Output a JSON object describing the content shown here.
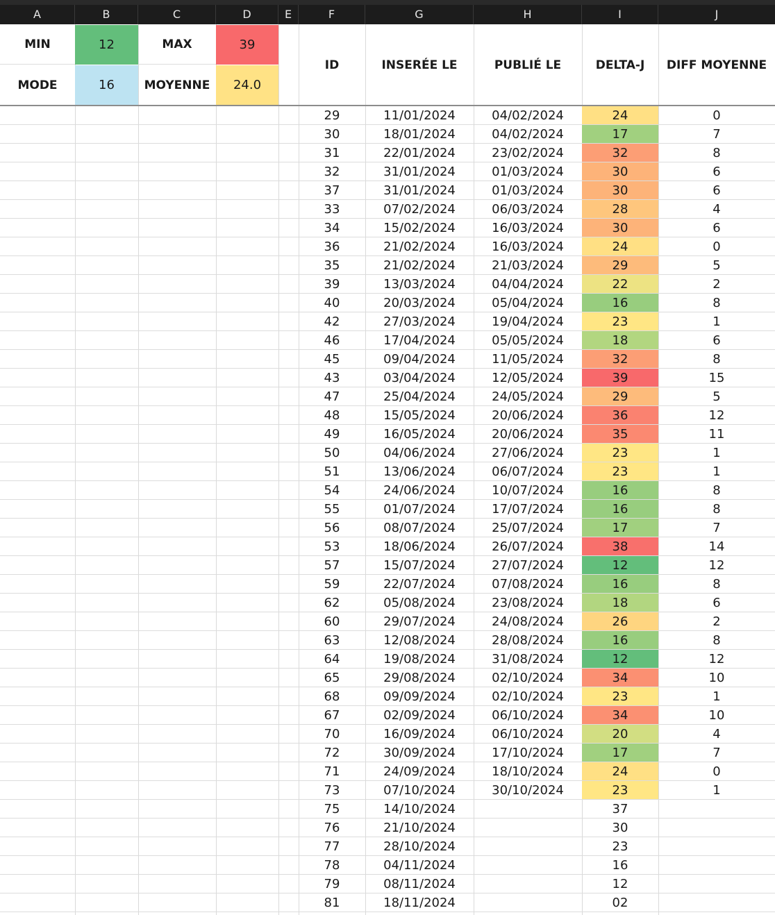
{
  "columns": [
    "A",
    "B",
    "C",
    "D",
    "E",
    "F",
    "G",
    "H",
    "I",
    "J"
  ],
  "stats": {
    "min_label": "MIN",
    "min_value": "12",
    "max_label": "MAX",
    "max_value": "39",
    "mode_label": "MODE",
    "mode_value": "16",
    "avg_label": "MOYENNE",
    "avg_value": "24.0"
  },
  "colors": {
    "min_bg": "#63be7b",
    "max_bg": "#f8696b",
    "mode_bg": "#bde3f2",
    "avg_bg": "#ffe285"
  },
  "table_headers": {
    "id": "ID",
    "inserted": "INSERÉE LE",
    "published": "PUBLIÉ LE",
    "delta": "DELTA-J",
    "diff": "DIFF MOYENNE"
  },
  "rows": [
    {
      "id": "29",
      "inserted": "11/01/2024",
      "published": "04/02/2024",
      "delta": "24",
      "diff": "0",
      "color": "#ffe084"
    },
    {
      "id": "30",
      "inserted": "18/01/2024",
      "published": "04/02/2024",
      "delta": "17",
      "diff": "7",
      "color": "#a1d07f"
    },
    {
      "id": "31",
      "inserted": "22/01/2024",
      "published": "23/02/2024",
      "delta": "32",
      "diff": "8",
      "color": "#fc9e75"
    },
    {
      "id": "32",
      "inserted": "31/01/2024",
      "published": "01/03/2024",
      "delta": "30",
      "diff": "6",
      "color": "#fdb379"
    },
    {
      "id": "37",
      "inserted": "31/01/2024",
      "published": "01/03/2024",
      "delta": "30",
      "diff": "6",
      "color": "#fdb379"
    },
    {
      "id": "33",
      "inserted": "07/02/2024",
      "published": "06/03/2024",
      "delta": "28",
      "diff": "4",
      "color": "#fec67d"
    },
    {
      "id": "34",
      "inserted": "15/02/2024",
      "published": "16/03/2024",
      "delta": "30",
      "diff": "6",
      "color": "#fdb379"
    },
    {
      "id": "36",
      "inserted": "21/02/2024",
      "published": "16/03/2024",
      "delta": "24",
      "diff": "0",
      "color": "#ffe084"
    },
    {
      "id": "35",
      "inserted": "21/02/2024",
      "published": "21/03/2024",
      "delta": "29",
      "diff": "5",
      "color": "#fdbb7b"
    },
    {
      "id": "39",
      "inserted": "13/03/2024",
      "published": "04/04/2024",
      "delta": "22",
      "diff": "2",
      "color": "#ede383"
    },
    {
      "id": "40",
      "inserted": "20/03/2024",
      "published": "05/04/2024",
      "delta": "16",
      "diff": "8",
      "color": "#98cd7e"
    },
    {
      "id": "42",
      "inserted": "27/03/2024",
      "published": "19/04/2024",
      "delta": "23",
      "diff": "1",
      "color": "#ffe684"
    },
    {
      "id": "46",
      "inserted": "17/04/2024",
      "published": "05/05/2024",
      "delta": "18",
      "diff": "6",
      "color": "#b2d680"
    },
    {
      "id": "45",
      "inserted": "09/04/2024",
      "published": "11/05/2024",
      "delta": "32",
      "diff": "8",
      "color": "#fc9e75"
    },
    {
      "id": "43",
      "inserted": "03/04/2024",
      "published": "12/05/2024",
      "delta": "39",
      "diff": "15",
      "color": "#f8696b"
    },
    {
      "id": "47",
      "inserted": "25/04/2024",
      "published": "24/05/2024",
      "delta": "29",
      "diff": "5",
      "color": "#fdbb7b"
    },
    {
      "id": "48",
      "inserted": "15/05/2024",
      "published": "20/06/2024",
      "delta": "36",
      "diff": "12",
      "color": "#fa8270"
    },
    {
      "id": "49",
      "inserted": "16/05/2024",
      "published": "20/06/2024",
      "delta": "35",
      "diff": "11",
      "color": "#fb8971"
    },
    {
      "id": "50",
      "inserted": "04/06/2024",
      "published": "27/06/2024",
      "delta": "23",
      "diff": "1",
      "color": "#ffe684"
    },
    {
      "id": "51",
      "inserted": "13/06/2024",
      "published": "06/07/2024",
      "delta": "23",
      "diff": "1",
      "color": "#ffe684"
    },
    {
      "id": "54",
      "inserted": "24/06/2024",
      "published": "10/07/2024",
      "delta": "16",
      "diff": "8",
      "color": "#98cd7e"
    },
    {
      "id": "55",
      "inserted": "01/07/2024",
      "published": "17/07/2024",
      "delta": "16",
      "diff": "8",
      "color": "#98cd7e"
    },
    {
      "id": "56",
      "inserted": "08/07/2024",
      "published": "25/07/2024",
      "delta": "17",
      "diff": "7",
      "color": "#a1d07f"
    },
    {
      "id": "53",
      "inserted": "18/06/2024",
      "published": "26/07/2024",
      "delta": "38",
      "diff": "14",
      "color": "#f8706c"
    },
    {
      "id": "57",
      "inserted": "15/07/2024",
      "published": "27/07/2024",
      "delta": "12",
      "diff": "12",
      "color": "#63be7b"
    },
    {
      "id": "59",
      "inserted": "22/07/2024",
      "published": "07/08/2024",
      "delta": "16",
      "diff": "8",
      "color": "#98cd7e"
    },
    {
      "id": "62",
      "inserted": "05/08/2024",
      "published": "23/08/2024",
      "delta": "18",
      "diff": "6",
      "color": "#b2d680"
    },
    {
      "id": "60",
      "inserted": "29/07/2024",
      "published": "24/08/2024",
      "delta": "26",
      "diff": "2",
      "color": "#fed580"
    },
    {
      "id": "63",
      "inserted": "12/08/2024",
      "published": "28/08/2024",
      "delta": "16",
      "diff": "8",
      "color": "#98cd7e"
    },
    {
      "id": "64",
      "inserted": "19/08/2024",
      "published": "31/08/2024",
      "delta": "12",
      "diff": "12",
      "color": "#63be7b"
    },
    {
      "id": "65",
      "inserted": "29/08/2024",
      "published": "02/10/2024",
      "delta": "34",
      "diff": "10",
      "color": "#fb9072"
    },
    {
      "id": "68",
      "inserted": "09/09/2024",
      "published": "02/10/2024",
      "delta": "23",
      "diff": "1",
      "color": "#ffe684"
    },
    {
      "id": "67",
      "inserted": "02/09/2024",
      "published": "06/10/2024",
      "delta": "34",
      "diff": "10",
      "color": "#fb9072"
    },
    {
      "id": "70",
      "inserted": "16/09/2024",
      "published": "06/10/2024",
      "delta": "20",
      "diff": "4",
      "color": "#d2de82"
    },
    {
      "id": "72",
      "inserted": "30/09/2024",
      "published": "17/10/2024",
      "delta": "17",
      "diff": "7",
      "color": "#a1d07f"
    },
    {
      "id": "71",
      "inserted": "24/09/2024",
      "published": "18/10/2024",
      "delta": "24",
      "diff": "0",
      "color": "#ffe084"
    },
    {
      "id": "73",
      "inserted": "07/10/2024",
      "published": "30/10/2024",
      "delta": "23",
      "diff": "1",
      "color": "#ffe684"
    },
    {
      "id": "75",
      "inserted": "14/10/2024",
      "published": "",
      "delta": "37",
      "diff": "",
      "color": ""
    },
    {
      "id": "76",
      "inserted": "21/10/2024",
      "published": "",
      "delta": "30",
      "diff": "",
      "color": ""
    },
    {
      "id": "77",
      "inserted": "28/10/2024",
      "published": "",
      "delta": "23",
      "diff": "",
      "color": ""
    },
    {
      "id": "78",
      "inserted": "04/11/2024",
      "published": "",
      "delta": "16",
      "diff": "",
      "color": ""
    },
    {
      "id": "79",
      "inserted": "08/11/2024",
      "published": "",
      "delta": "12",
      "diff": "",
      "color": ""
    },
    {
      "id": "81",
      "inserted": "18/11/2024",
      "published": "",
      "delta": "02",
      "diff": "",
      "color": ""
    }
  ]
}
